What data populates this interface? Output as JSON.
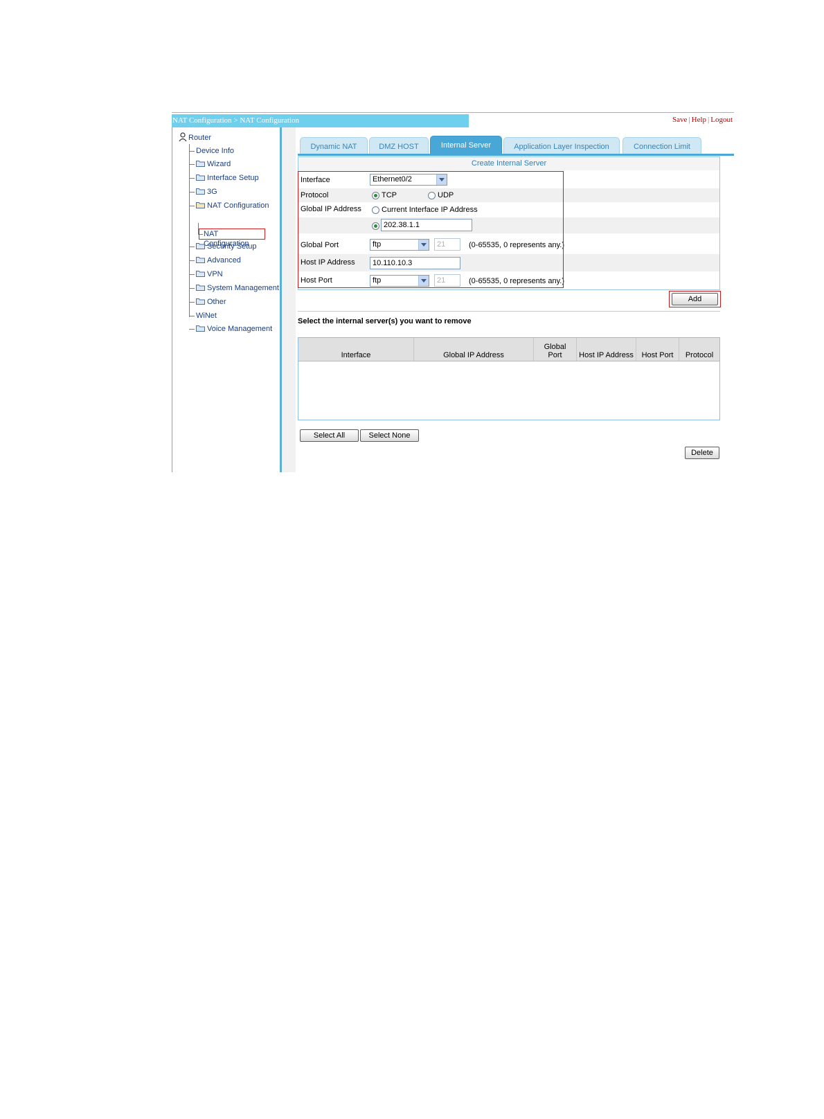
{
  "breadcrumb": "NAT Configuration > NAT Configuration",
  "toplinks": {
    "save": "Save",
    "help": "Help",
    "logout": "Logout",
    "sep": "|"
  },
  "sidebar": {
    "root": "Router",
    "items": [
      {
        "label": "Device Info",
        "type": "leaf"
      },
      {
        "label": "Wizard",
        "type": "folder"
      },
      {
        "label": "Interface Setup",
        "type": "folder"
      },
      {
        "label": "3G",
        "type": "folder"
      },
      {
        "label": "NAT Configuration",
        "type": "folder"
      },
      {
        "label": "Security Setup",
        "type": "folder"
      },
      {
        "label": "Advanced",
        "type": "folder"
      },
      {
        "label": "VPN",
        "type": "folder"
      },
      {
        "label": "System Management",
        "type": "folder"
      },
      {
        "label": "Other",
        "type": "folder"
      },
      {
        "label": "WiNet",
        "type": "leaf"
      },
      {
        "label": "Voice Management",
        "type": "folder"
      }
    ],
    "selected_sub": "NAT Configuration"
  },
  "tabs": [
    {
      "label": "Dynamic NAT",
      "active": false
    },
    {
      "label": "DMZ HOST",
      "active": false
    },
    {
      "label": "Internal Server",
      "active": true
    },
    {
      "label": "Application Layer Inspection",
      "active": false
    },
    {
      "label": "Connection Limit",
      "active": false
    }
  ],
  "create": {
    "title": "Create Internal Server",
    "interface_label": "Interface",
    "interface_value": "Ethernet0/2",
    "protocol_label": "Protocol",
    "protocol_options": [
      "TCP",
      "UDP"
    ],
    "protocol_selected": "TCP",
    "global_ip_label": "Global IP Address",
    "current_iface_option": "Current Interface IP Address",
    "global_ip_value": "202.38.1.1",
    "global_port_label": "Global Port",
    "global_port_service": "ftp",
    "global_port_number": "21",
    "port_hint": "(0-65535, 0 represents any.)",
    "host_ip_label": "Host IP Address",
    "host_ip_value": "10.110.10.3",
    "host_port_label": "Host Port",
    "host_port_service": "ftp",
    "host_port_number": "21",
    "add_button": "Add"
  },
  "remove": {
    "title": "Select the internal server(s) you want to remove",
    "columns": [
      "Interface",
      "Global IP Address",
      "Global Port",
      "Host IP Address",
      "Host Port",
      "Protocol"
    ],
    "select_all": "Select All",
    "select_none": "Select None",
    "delete": "Delete"
  },
  "colors": {
    "accent": "#49a7d7",
    "breadcrumb_bg": "#6fd0ee",
    "highlight": "#cc1a1a",
    "link": "#c00000"
  }
}
